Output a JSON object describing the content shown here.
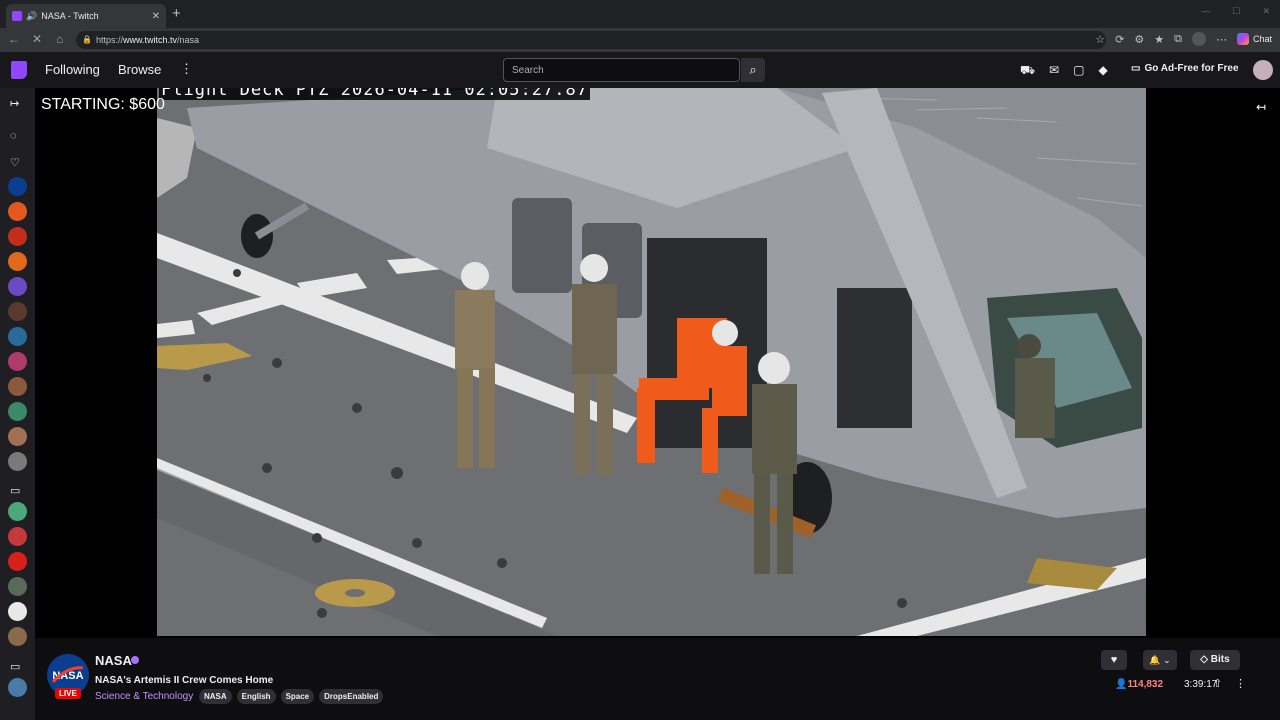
{
  "browser": {
    "tab_title": "NASA - Twitch",
    "new_tab": "+",
    "url_scheme": "https://",
    "url_host": "www.twitch.tv",
    "url_path": "/nasa",
    "chat_label": "Chat"
  },
  "topnav": {
    "following": "Following",
    "browse": "Browse",
    "search_placeholder": "Search",
    "ad_free": "Go Ad-Free for Free"
  },
  "player": {
    "starting_text": "STARTING: $600",
    "osd_text": "Flight Deck PTZ 2026-04-11 02:05:27.87"
  },
  "channel": {
    "name": "NASA",
    "live_badge": "LIVE",
    "title": "NASA's Artemis II Crew Comes Home",
    "category": "Science & Technology",
    "tags": [
      "NASA",
      "English",
      "Space",
      "DropsEnabled"
    ],
    "viewers": "114,832",
    "uptime": "3:39:17",
    "bits_label": "Bits"
  },
  "colors": {
    "twitch_purple": "#9146ff",
    "live_red": "#eb0400",
    "viewers_red": "#ff8280",
    "category_purple": "#bf94ff",
    "flight_suit_orange": "#f05a1a"
  }
}
